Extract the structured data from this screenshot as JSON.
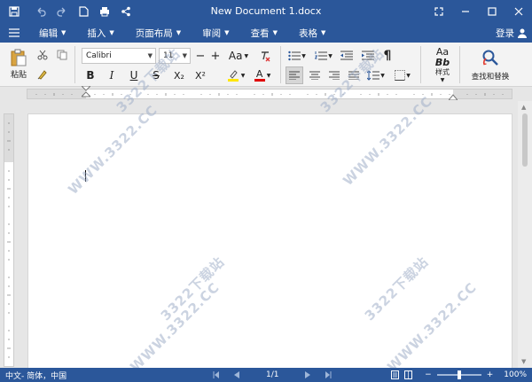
{
  "window": {
    "title": "New Document 1.docx",
    "login_label": "登录"
  },
  "menu": {
    "items": [
      {
        "label": "编辑"
      },
      {
        "label": "插入"
      },
      {
        "label": "页面布局"
      },
      {
        "label": "审阅"
      },
      {
        "label": "查看"
      },
      {
        "label": "表格"
      }
    ]
  },
  "ribbon": {
    "paste_label": "粘贴",
    "font_name": "Calibri",
    "font_size": "11",
    "styles_label": "样式",
    "find_replace_label": "查找和替换",
    "bold": "B",
    "italic": "I",
    "underline": "U",
    "strike": "S",
    "subscript": "X₂",
    "superscript": "X²",
    "grow_font": "+",
    "shrink_font": "−",
    "change_case": "Aa",
    "font_color_letter": "A",
    "styles_preview_top": "Aa",
    "styles_preview_bottom": "Bb",
    "pilcrow": "¶"
  },
  "statusbar": {
    "language": "中文- 简体，中国",
    "page_indicator": "1/1",
    "zoom": "100%",
    "zoom_minus": "−",
    "zoom_plus": "+"
  },
  "watermark": {
    "text": "WWW.3322.CC",
    "text2": "3322下载站"
  },
  "colors": {
    "title_bar": "#2b579a",
    "ribbon_bg": "#f3f3f3",
    "highlight": "#ffe600",
    "font_color": "#e00000"
  }
}
